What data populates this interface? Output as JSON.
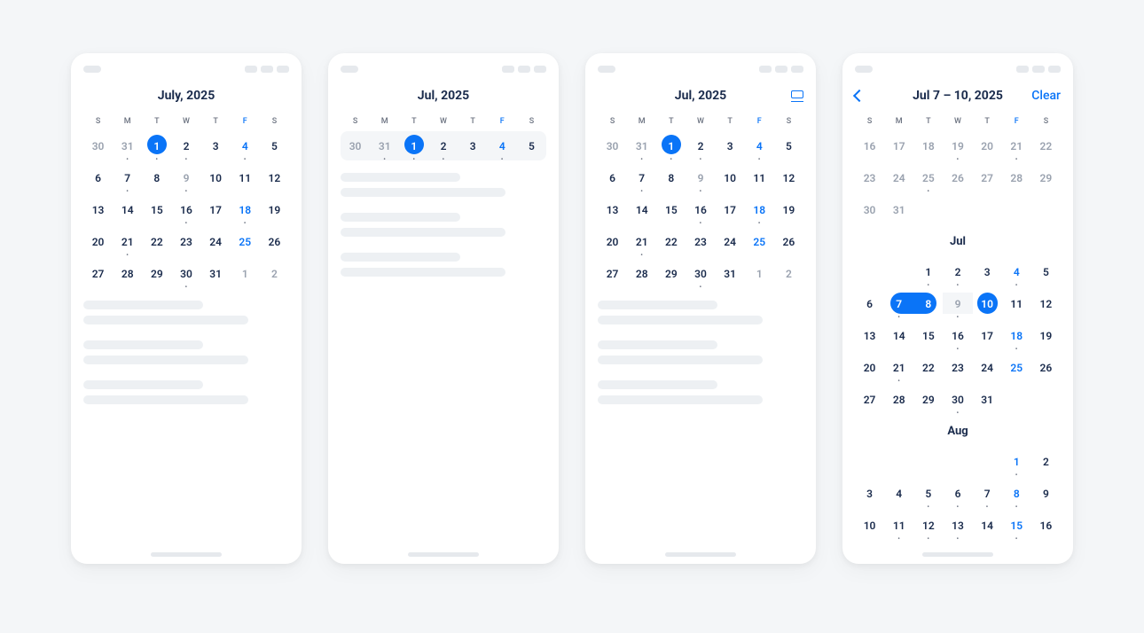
{
  "dow": [
    "S",
    "M",
    "T",
    "W",
    "T",
    "F",
    "S"
  ],
  "panels": [
    {
      "title": "July, 2025",
      "hasViewIcon": false,
      "hasBack": false,
      "hasClear": false,
      "weekHighlight": false,
      "weeks": [
        [
          {
            "n": "30",
            "muted": true,
            "dot": false
          },
          {
            "n": "31",
            "muted": true,
            "dot": true
          },
          {
            "n": "1",
            "today": true,
            "dot": true
          },
          {
            "n": "2",
            "dot": true
          },
          {
            "n": "3",
            "dot": false
          },
          {
            "n": "4",
            "friday": true,
            "dot": true
          },
          {
            "n": "5",
            "dot": false
          }
        ],
        [
          {
            "n": "6"
          },
          {
            "n": "7",
            "dot": true
          },
          {
            "n": "8"
          },
          {
            "n": "9",
            "muted": true,
            "dot": true
          },
          {
            "n": "10"
          },
          {
            "n": "11"
          },
          {
            "n": "12"
          }
        ],
        [
          {
            "n": "13"
          },
          {
            "n": "14"
          },
          {
            "n": "15"
          },
          {
            "n": "16",
            "dot": true
          },
          {
            "n": "17"
          },
          {
            "n": "18",
            "friday": true,
            "dot": true
          },
          {
            "n": "19"
          }
        ],
        [
          {
            "n": "20"
          },
          {
            "n": "21",
            "dot": true
          },
          {
            "n": "22"
          },
          {
            "n": "23"
          },
          {
            "n": "24"
          },
          {
            "n": "25",
            "friday": true
          },
          {
            "n": "26"
          }
        ],
        [
          {
            "n": "27"
          },
          {
            "n": "28"
          },
          {
            "n": "29"
          },
          {
            "n": "30",
            "dot": true
          },
          {
            "n": "31"
          },
          {
            "n": "1",
            "muted": true
          },
          {
            "n": "2",
            "muted": true
          }
        ]
      ],
      "events": 3
    },
    {
      "title": "Jul, 2025",
      "hasViewIcon": false,
      "hasBack": false,
      "hasClear": false,
      "weekHighlight": true,
      "weeks": [
        [
          {
            "n": "30",
            "muted": true
          },
          {
            "n": "31",
            "muted": true,
            "dot": true
          },
          {
            "n": "1",
            "today": true,
            "dot": true
          },
          {
            "n": "2",
            "dot": true
          },
          {
            "n": "3"
          },
          {
            "n": "4",
            "friday": true,
            "dot": true
          },
          {
            "n": "5"
          }
        ]
      ],
      "events": 3
    },
    {
      "title": "Jul, 2025",
      "hasViewIcon": true,
      "hasBack": false,
      "hasClear": false,
      "weekHighlight": false,
      "weeks": [
        [
          {
            "n": "30",
            "muted": true
          },
          {
            "n": "31",
            "muted": true,
            "dot": true
          },
          {
            "n": "1",
            "today": true,
            "dot": true
          },
          {
            "n": "2",
            "dot": true
          },
          {
            "n": "3"
          },
          {
            "n": "4",
            "friday": true,
            "dot": true
          },
          {
            "n": "5"
          }
        ],
        [
          {
            "n": "6"
          },
          {
            "n": "7",
            "dot": true
          },
          {
            "n": "8"
          },
          {
            "n": "9",
            "muted": true,
            "dot": true
          },
          {
            "n": "10"
          },
          {
            "n": "11"
          },
          {
            "n": "12"
          }
        ],
        [
          {
            "n": "13"
          },
          {
            "n": "14"
          },
          {
            "n": "15"
          },
          {
            "n": "16",
            "dot": true
          },
          {
            "n": "17"
          },
          {
            "n": "18",
            "friday": true,
            "dot": true
          },
          {
            "n": "19"
          }
        ],
        [
          {
            "n": "20"
          },
          {
            "n": "21",
            "dot": true
          },
          {
            "n": "22"
          },
          {
            "n": "23"
          },
          {
            "n": "24"
          },
          {
            "n": "25",
            "friday": true
          },
          {
            "n": "26"
          }
        ],
        [
          {
            "n": "27"
          },
          {
            "n": "28"
          },
          {
            "n": "29"
          },
          {
            "n": "30",
            "dot": true
          },
          {
            "n": "31"
          },
          {
            "n": "1",
            "muted": true
          },
          {
            "n": "2",
            "muted": true
          }
        ]
      ],
      "events": 3
    },
    {
      "title": "Jul 7 – 10, 2025",
      "hasViewIcon": false,
      "hasBack": true,
      "hasClear": true,
      "clearLabel": "Clear",
      "months": [
        {
          "label": null,
          "weeks": [
            [
              {
                "n": "16",
                "muted": true
              },
              {
                "n": "17",
                "muted": true
              },
              {
                "n": "18",
                "muted": true
              },
              {
                "n": "19",
                "muted": true,
                "dot": true
              },
              {
                "n": "20",
                "muted": true
              },
              {
                "n": "21",
                "muted": true,
                "dot": true
              },
              {
                "n": "22",
                "muted": true
              }
            ],
            [
              {
                "n": "23",
                "muted": true
              },
              {
                "n": "24",
                "muted": true
              },
              {
                "n": "25",
                "muted": true,
                "dot": true
              },
              {
                "n": "26",
                "muted": true
              },
              {
                "n": "27",
                "muted": true
              },
              {
                "n": "28",
                "muted": true
              },
              {
                "n": "29",
                "muted": true
              }
            ],
            [
              {
                "n": "30",
                "muted": true
              },
              {
                "n": "31",
                "muted": true
              },
              {
                "n": "",
                "blank": true
              },
              {
                "n": "",
                "blank": true
              },
              {
                "n": "",
                "blank": true
              },
              {
                "n": "",
                "blank": true
              },
              {
                "n": "",
                "blank": true
              }
            ]
          ]
        },
        {
          "label": "Jul",
          "weeks": [
            [
              {
                "n": "",
                "blank": true
              },
              {
                "n": "",
                "blank": true
              },
              {
                "n": "1",
                "dot": true
              },
              {
                "n": "2",
                "dot": true
              },
              {
                "n": "3"
              },
              {
                "n": "4",
                "friday": true,
                "dot": true
              },
              {
                "n": "5"
              }
            ],
            [
              {
                "n": "6"
              },
              {
                "n": "7",
                "range": "start",
                "dot": true
              },
              {
                "n": "8",
                "range": "end"
              },
              {
                "n": "9",
                "range": "gap",
                "dot": true
              },
              {
                "n": "10",
                "range": "single"
              },
              {
                "n": "11"
              },
              {
                "n": "12"
              }
            ],
            [
              {
                "n": "13"
              },
              {
                "n": "14"
              },
              {
                "n": "15"
              },
              {
                "n": "16",
                "dot": true
              },
              {
                "n": "17"
              },
              {
                "n": "18",
                "friday": true,
                "dot": true
              },
              {
                "n": "19"
              }
            ],
            [
              {
                "n": "20"
              },
              {
                "n": "21",
                "dot": true
              },
              {
                "n": "22"
              },
              {
                "n": "23"
              },
              {
                "n": "24"
              },
              {
                "n": "25",
                "friday": true
              },
              {
                "n": "26"
              }
            ],
            [
              {
                "n": "27"
              },
              {
                "n": "28"
              },
              {
                "n": "29"
              },
              {
                "n": "30",
                "dot": true
              },
              {
                "n": "31"
              },
              {
                "n": "",
                "blank": true
              },
              {
                "n": "",
                "blank": true
              }
            ]
          ]
        },
        {
          "label": "Aug",
          "weeks": [
            [
              {
                "n": "",
                "blank": true
              },
              {
                "n": "",
                "blank": true
              },
              {
                "n": "",
                "blank": true
              },
              {
                "n": "",
                "blank": true
              },
              {
                "n": "",
                "blank": true
              },
              {
                "n": "1",
                "friday": true,
                "dot": true
              },
              {
                "n": "2"
              }
            ],
            [
              {
                "n": "3"
              },
              {
                "n": "4"
              },
              {
                "n": "5",
                "dot": true
              },
              {
                "n": "6",
                "dot": true
              },
              {
                "n": "7",
                "dot": true
              },
              {
                "n": "8",
                "friday": true,
                "dot": true
              },
              {
                "n": "9"
              }
            ],
            [
              {
                "n": "10"
              },
              {
                "n": "11",
                "dot": true
              },
              {
                "n": "12",
                "dot": true
              },
              {
                "n": "13",
                "dot": true
              },
              {
                "n": "14"
              },
              {
                "n": "15",
                "friday": true,
                "dot": true
              },
              {
                "n": "16"
              }
            ]
          ]
        }
      ]
    }
  ]
}
